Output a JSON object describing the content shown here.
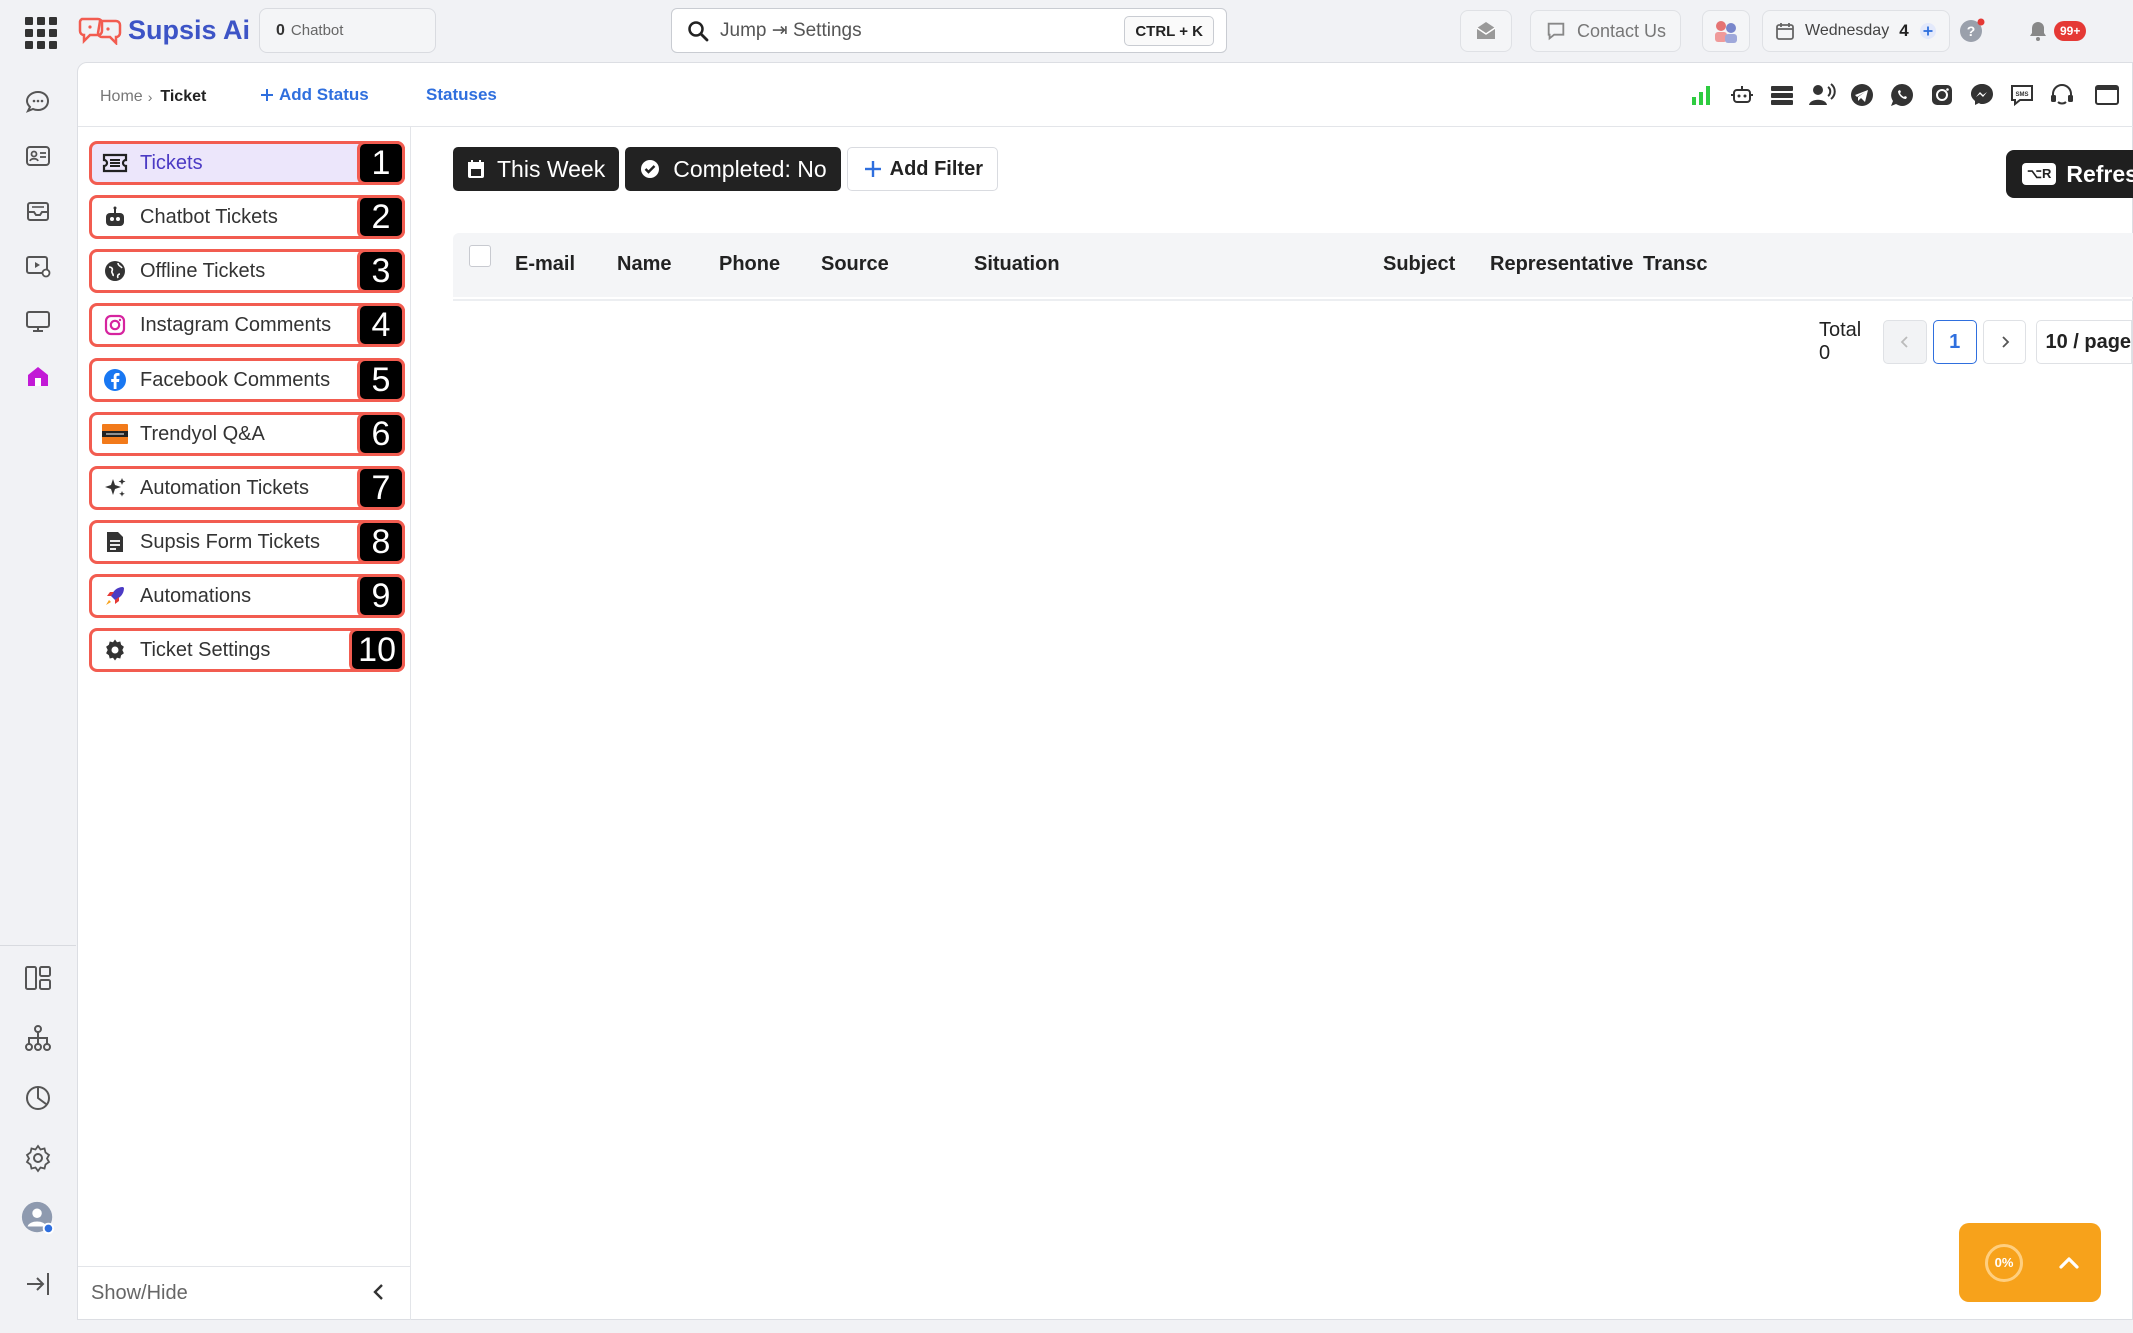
{
  "topbar": {
    "app_name": "Supsis Ai",
    "chatbot_count": "0",
    "chatbot_label": "Chatbot",
    "search_value": "Jump ⇥ Settings",
    "search_shortcut": "CTRL + K",
    "contact_label": "Contact Us",
    "date_day": "Wednesday",
    "date_num": "4",
    "notif_badge": "99+"
  },
  "breadcrumb": {
    "home": "Home",
    "current": "Ticket",
    "add_status": "Add Status",
    "statuses": "Statuses"
  },
  "menu": {
    "items": [
      {
        "label": "Tickets",
        "num": "1",
        "icon": "ticket-icon"
      },
      {
        "label": "Chatbot Tickets",
        "num": "2",
        "icon": "robot-icon"
      },
      {
        "label": "Offline Tickets",
        "num": "3",
        "icon": "globe-icon"
      },
      {
        "label": "Instagram Comments",
        "num": "4",
        "icon": "instagram-icon"
      },
      {
        "label": "Facebook Comments",
        "num": "5",
        "icon": "facebook-icon"
      },
      {
        "label": "Trendyol Q&A",
        "num": "6",
        "icon": "trendyol-icon"
      },
      {
        "label": "Automation Tickets",
        "num": "7",
        "icon": "sparkle-icon"
      },
      {
        "label": "Supsis Form Tickets",
        "num": "8",
        "icon": "document-icon"
      },
      {
        "label": "Automations",
        "num": "9",
        "icon": "rocket-icon"
      },
      {
        "label": "Ticket Settings",
        "num": "10",
        "icon": "gear-icon"
      }
    ],
    "show_hide": "Show/Hide"
  },
  "filters": {
    "this_week": "This Week",
    "completed": "Completed: No",
    "add_filter": "Add Filter",
    "refresh_kbd": "⌥R",
    "refresh": "Refresh"
  },
  "table": {
    "columns": [
      "E-mail",
      "Name",
      "Phone",
      "Source",
      "Situation",
      "Subject",
      "Representative",
      "Transc"
    ]
  },
  "pager": {
    "total": "Total 0",
    "page": "1",
    "page_size": "10 / page"
  },
  "widget": {
    "progress": "0%"
  },
  "colors": {
    "brand": "#3d54c6",
    "link": "#2f6fde",
    "highlight_border": "#f25c50",
    "active_bg": "#ece6fb",
    "widget": "#f7a21b"
  }
}
